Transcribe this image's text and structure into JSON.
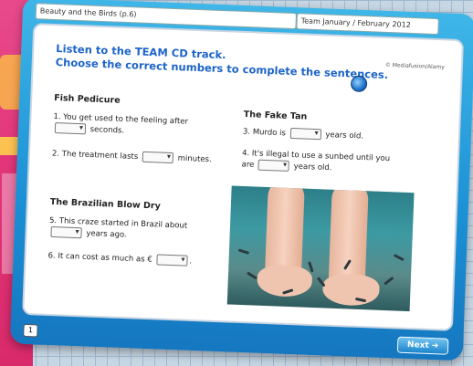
{
  "header": {
    "title_field": "Beauty and the Birds (p.6)",
    "issue_field": "Team January / February 2012",
    "copyright": "© Mediafusion/Alamy"
  },
  "instructions": {
    "line1": "Listen to the TEAM CD track.",
    "line2": "Choose the correct numbers to complete the sentences."
  },
  "sections": {
    "fish_pedicure": {
      "heading": "Fish Pedicure",
      "q1_before": "1. You get used to the feeling after",
      "q1_after": "seconds.",
      "q2_before": "2. The treatment lasts",
      "q2_after": "minutes."
    },
    "fake_tan": {
      "heading": "The Fake Tan",
      "q3_before": "3. Murdo is",
      "q3_after": "years old.",
      "q4_before": "4. It's illegal to use a sunbed until you",
      "q4_mid": "are",
      "q4_after": "years old."
    },
    "blow_dry": {
      "heading": "The Brazilian Blow Dry",
      "q5_before": "5. This craze started in Brazil about",
      "q5_after": "years ago.",
      "q6_before": "6. It can cost as much as €",
      "q6_after": "."
    }
  },
  "footer": {
    "page_number": "1",
    "next_label": "Next"
  },
  "icons": {
    "audio": "globe-audio-icon",
    "next_arrow": "arrow-right-icon",
    "dropdown": "chevron-down-icon"
  },
  "colors": {
    "frame_blue": "#1b8fd4",
    "title_blue": "#1d64c8",
    "magazine_pink": "#e2367a"
  }
}
